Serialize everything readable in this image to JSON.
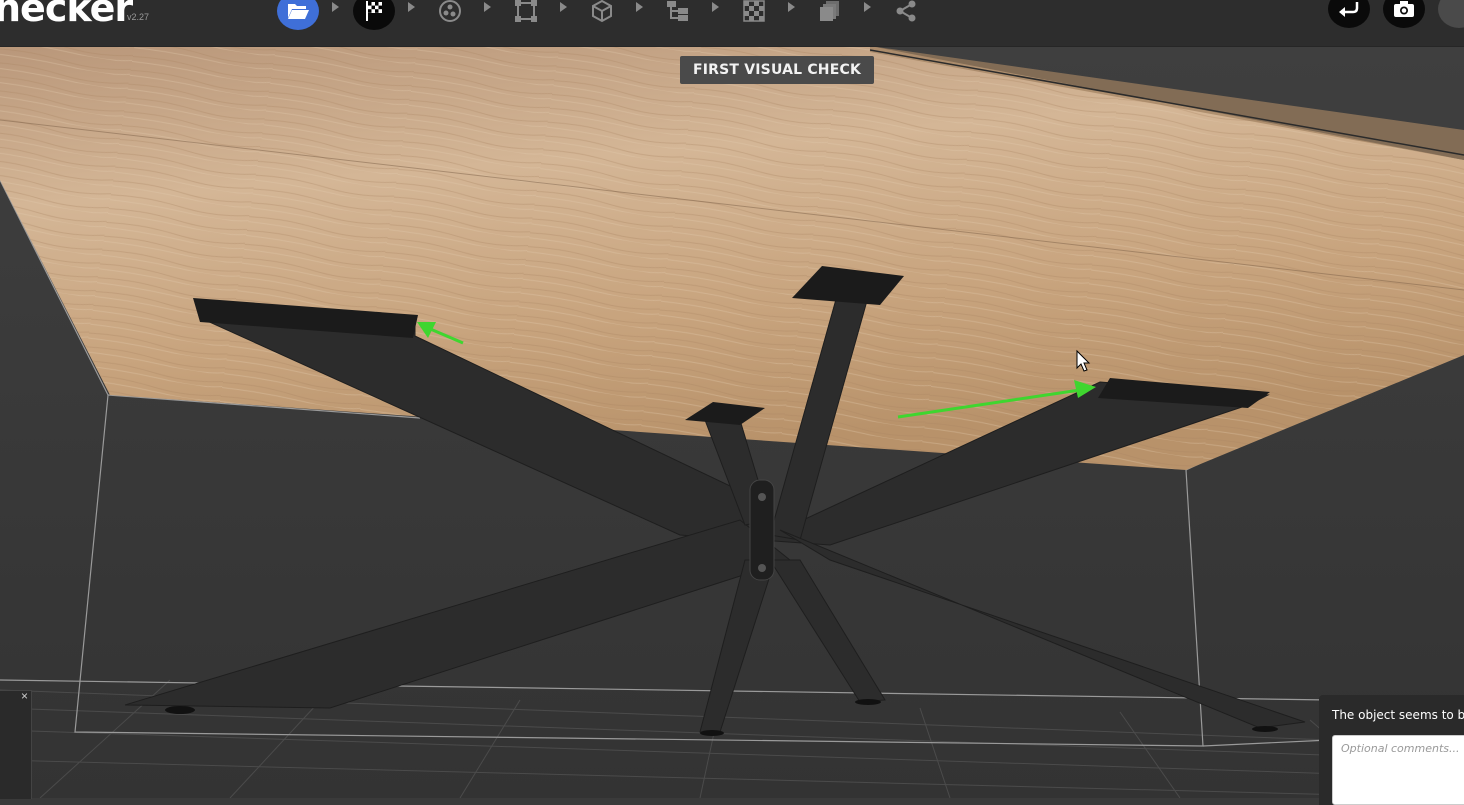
{
  "app": {
    "name": "Checker",
    "brand_visible": "hecker",
    "version": "v2.27"
  },
  "workflow": {
    "steps": [
      {
        "icon": "folder-open-icon",
        "state": "done"
      },
      {
        "icon": "checkered-flag-icon",
        "state": "current"
      },
      {
        "icon": "atom-icon",
        "state": "pending"
      },
      {
        "icon": "bounding-box-icon",
        "state": "pending"
      },
      {
        "icon": "cube-icon",
        "state": "pending"
      },
      {
        "icon": "hierarchy-icon",
        "state": "pending"
      },
      {
        "icon": "checkerboard-icon",
        "state": "pending"
      },
      {
        "icon": "layers-icon",
        "state": "pending"
      },
      {
        "icon": "share-icon",
        "state": "pending"
      }
    ]
  },
  "toolbar": {
    "undo_icon": "return-arrow-icon",
    "screenshot_icon": "camera-icon"
  },
  "viewport": {
    "step_label": "FIRST VISUAL CHECK",
    "annotation_color": "#3fd62f",
    "wood_color": "#c8a47e",
    "metal_color": "#2a2a2a"
  },
  "left_panel": {
    "close_label": "×"
  },
  "comment_panel": {
    "message": "The object seems to be vi",
    "placeholder": "Optional comments..."
  }
}
